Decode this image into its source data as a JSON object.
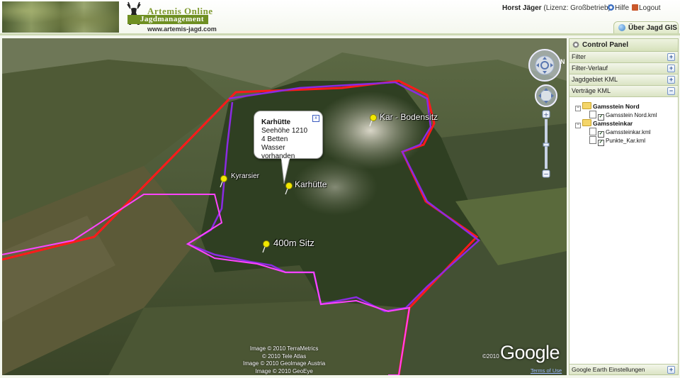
{
  "header": {
    "logo_top": "Artemis Online",
    "logo_band": "Jagdmanagement",
    "logo_url": "www.artemis-jagd.com",
    "user_name": "Horst Jäger",
    "license": "(Lizenz: Großbetrieb)",
    "help_label": "Hilfe",
    "logout_label": "Logout",
    "tab_label": "Über Jagd GIS"
  },
  "map": {
    "pins": [
      {
        "label": "Kar - Bodensitz"
      },
      {
        "label": "Kyrarsier"
      },
      {
        "label": "Karhütte"
      },
      {
        "label": "400m Sitz"
      }
    ],
    "infowindow": {
      "title": "Karhütte",
      "lines": [
        "Seehöhe 1210",
        "4 Betten",
        "Wasser vorhanden"
      ],
      "close_symbol": "x"
    },
    "nav_north": "N",
    "credits": [
      "Image © 2010 TerraMetrics",
      "© 2010 Tele Atlas",
      "Image © 2010 Geolmage Austria",
      "Image © 2010 GeoEye"
    ],
    "copyright": "©2010",
    "google_logo": "Google",
    "terms": "Terms of Use",
    "colors": {
      "red_boundary": "#ff1a1a",
      "purple_boundary": "#8a2be2",
      "magenta_boundary": "#ff44ff",
      "pin": "#f2e800"
    }
  },
  "panel": {
    "title": "Control Panel",
    "sections": [
      {
        "label": "Filter",
        "toggle": "+"
      },
      {
        "label": "Filter-Verlauf",
        "toggle": "+"
      },
      {
        "label": "Jagdgebiet KML",
        "toggle": "+"
      },
      {
        "label": "Verträge KML",
        "toggle": "−"
      }
    ],
    "tree": {
      "folder1": "Gamsstein Nord",
      "folder1_files": [
        "Gamsstein Nord.kml"
      ],
      "folder2": "Gamssteinkar",
      "folder2_files": [
        "Gamssteinkar.kml",
        "Punkte_Kar.kml"
      ]
    },
    "footer": {
      "label": "Google Earth Einstellungen",
      "toggle": "+"
    }
  }
}
